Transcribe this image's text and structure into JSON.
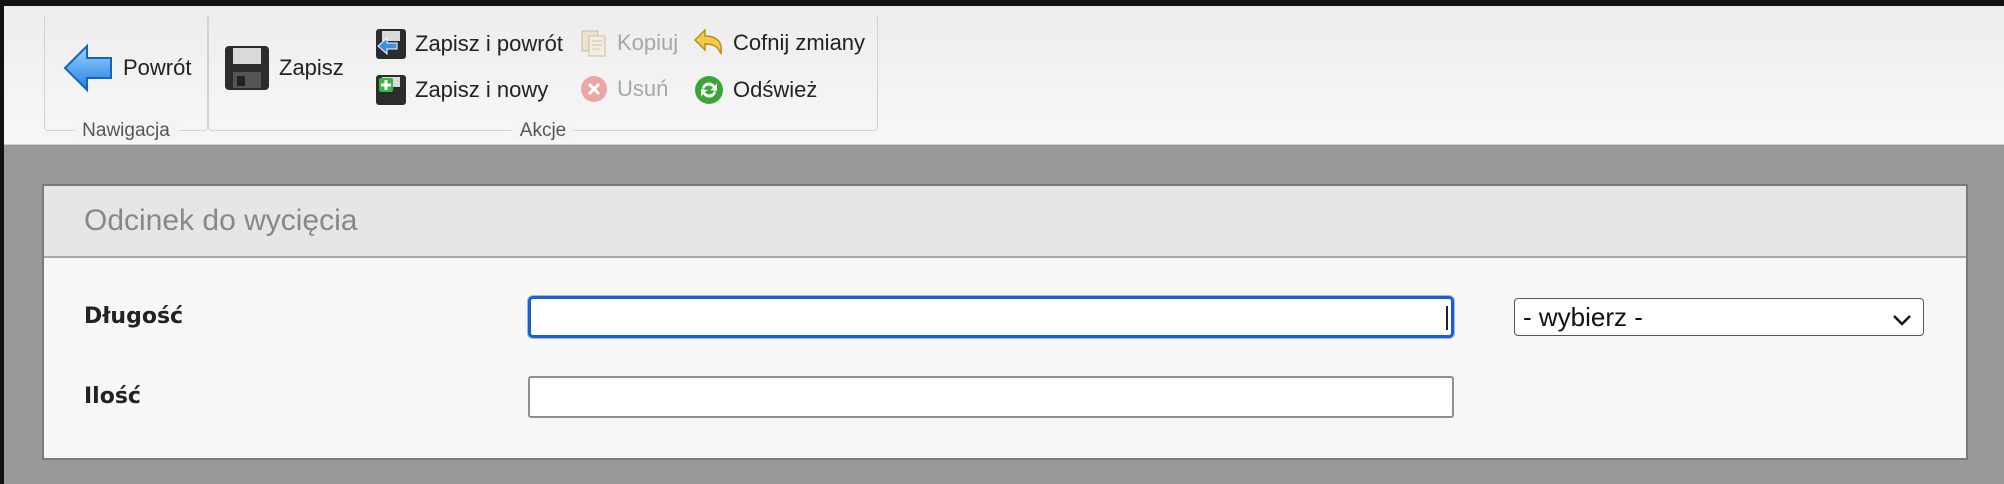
{
  "ribbon": {
    "groups": {
      "navigation": "Nawigacja",
      "actions": "Akcje"
    },
    "buttons": {
      "back": "Powrót",
      "save": "Zapisz",
      "save_and_back": "Zapisz i powrót",
      "save_and_new": "Zapisz i nowy",
      "copy": "Kopiuj",
      "delete": "Usuń",
      "undo_changes": "Cofnij zmiany",
      "refresh": "Odśwież"
    }
  },
  "panel": {
    "title": "Odcinek do wycięcia",
    "fields": {
      "length_label": "Długość",
      "length_value": "",
      "unit_select": "- wybierz -",
      "quantity_label": "Ilość",
      "quantity_value": ""
    }
  },
  "colors": {
    "focus": "#1a5fd0",
    "background": "#999999",
    "panel_header": "#e6e6e6"
  },
  "icons": {
    "back": "arrow-left-icon",
    "save": "floppy-disk-icon",
    "save_and_back": "floppy-arrow-icon",
    "save_and_new": "floppy-plus-icon",
    "copy": "copy-icon",
    "delete": "delete-icon",
    "undo_changes": "undo-icon",
    "refresh": "refresh-icon"
  }
}
